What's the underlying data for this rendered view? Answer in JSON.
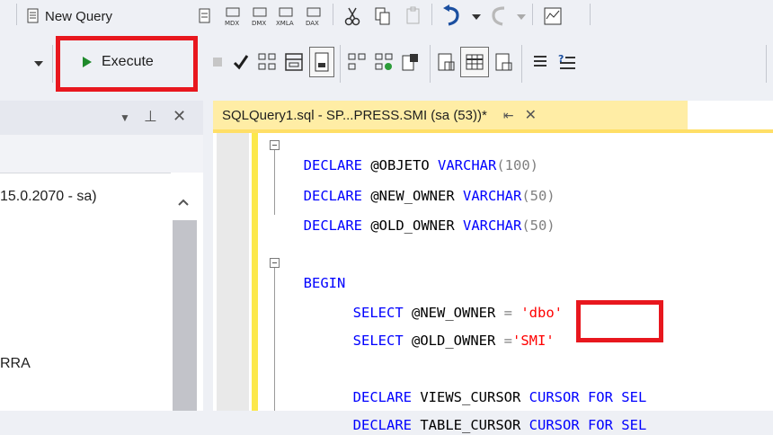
{
  "toolbar_top": {
    "new_query_label": "New Query",
    "icons": [
      "new-query-icon",
      "mdx-query-icon",
      "dmx-query-icon",
      "xmla-query-icon",
      "dax-query-icon",
      "cut-icon",
      "copy-icon",
      "paste-icon",
      "undo-icon",
      "redo-icon",
      "activity-monitor-icon"
    ]
  },
  "toolbar_query": {
    "execute_label": "Execute",
    "icons": [
      "stop-icon",
      "parse-check-icon",
      "display-plan-icon",
      "query-options-icon",
      "results-to-text-icon",
      "intellisense-icon",
      "include-plan-icon",
      "client-stats-icon",
      "results-to-grid-icon",
      "results-to-file-icon",
      "comment-icon",
      "uncomment-icon"
    ]
  },
  "object_explorer": {
    "connection_label": "15.0.2070 - sa)",
    "visible_item": "RRA"
  },
  "editor": {
    "tab_title": "SQLQuery1.sql - SP...PRESS.SMI (sa (53))*",
    "pin_glyph": "⇤",
    "close_glyph": "✕",
    "lines": [
      {
        "k1": "DECLARE",
        "t1": " @OBJETO ",
        "k2": "VARCHAR",
        "t2": "(100)"
      },
      {
        "k1": "DECLARE",
        "t1": " @NEW_OWNER ",
        "k2": "VARCHAR",
        "t2": "(50)"
      },
      {
        "k1": "DECLARE",
        "t1": " @OLD_OWNER ",
        "k2": "VARCHAR",
        "t2": "(50)"
      },
      {
        "k1": "BEGIN"
      },
      {
        "k1": "SELECT",
        "t1": " @NEW_OWNER ",
        "op": "=",
        "s": "'dbo'"
      },
      {
        "k1": "SELECT",
        "t1": " @OLD_OWNER ",
        "op": "=",
        "s": "'SMI'"
      },
      {
        "k1": "DECLARE",
        "t1": " VIEWS_CURSOR ",
        "k2": "CURSOR FOR SEL"
      },
      {
        "k1": "DECLARE",
        "t1": " TABLE_CURSOR ",
        "k2": "CURSOR FOR SEL"
      }
    ]
  },
  "colors": {
    "highlight_box": "#e8171e",
    "keyword": "#0000ff",
    "string": "#ff0000",
    "tab_active": "#ffeda5"
  }
}
